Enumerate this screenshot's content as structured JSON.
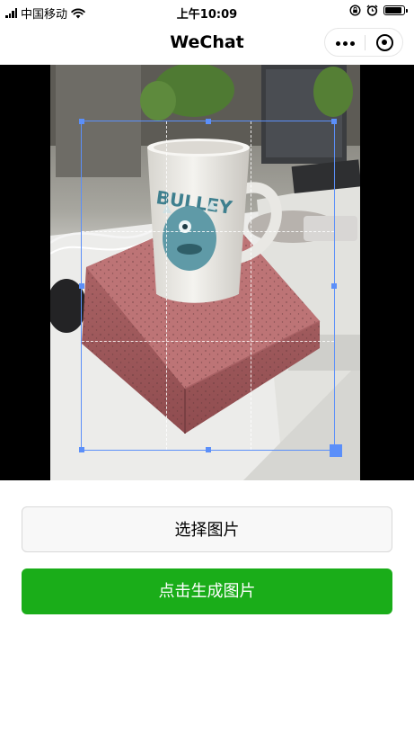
{
  "status_bar": {
    "carrier": "中国移动",
    "time": "上午10:09",
    "signal_bars": 4,
    "battery_level": 0.95,
    "icons": [
      "signal-icon",
      "wifi-icon",
      "screen-lock-icon",
      "alarm-icon",
      "battery-icon"
    ]
  },
  "nav": {
    "title": "WeChat",
    "capsule_icons": [
      "more-icon",
      "close-miniprogram-icon"
    ]
  },
  "cropper": {
    "image_subject": "white mug with monster print standing on a red brick on an office desk",
    "accent_color": "#5b8ff9"
  },
  "buttons": {
    "choose_label": "选择图片",
    "generate_label": "点击生成图片",
    "generate_color": "#1aad19"
  }
}
